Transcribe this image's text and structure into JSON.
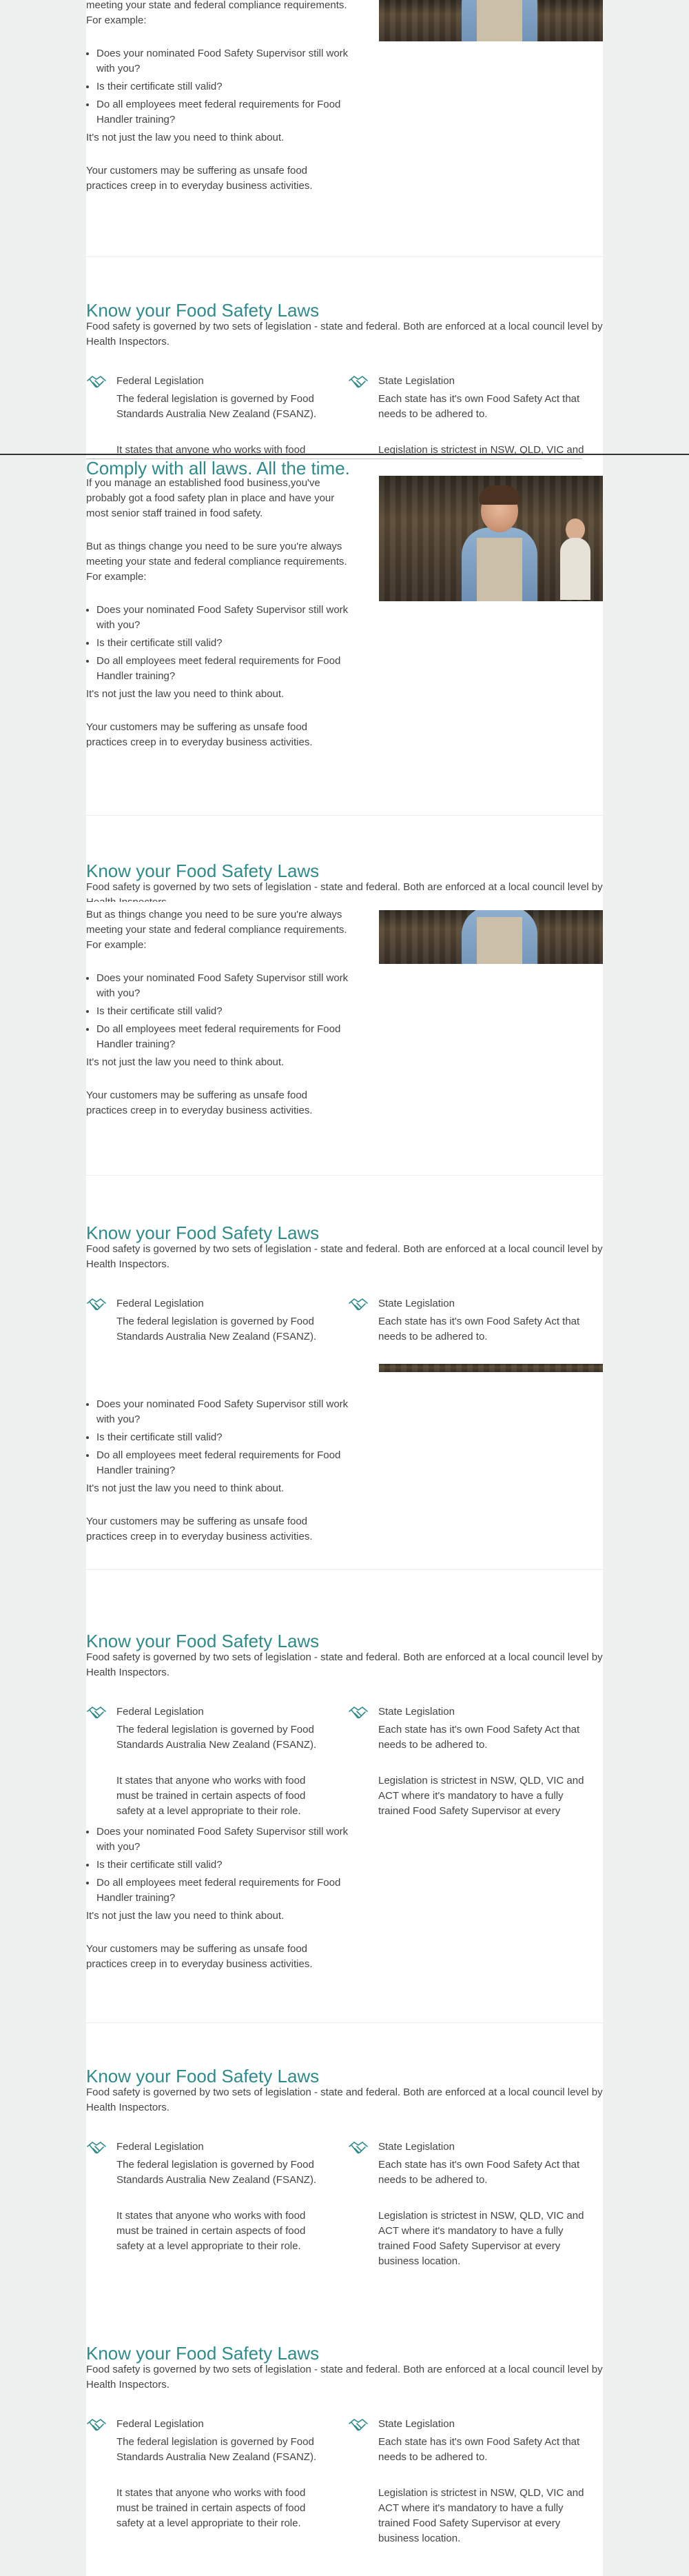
{
  "comply": {
    "title": "Comply with all laws. All the time.",
    "intro": "If you manage an established food business,you've probably got a food safety plan in place and have your most senior staff trained in food safety.",
    "change": "But as things change you need to be sure you're always meeting your state and federal compliance requirements. For example:",
    "change_tail": "meeting your state and federal compliance requirements. For example:",
    "bullets": [
      "Does your nominated Food Safety Supervisor still work with you?",
      "Is their certificate still valid?",
      "Do all employees meet federal requirements for Food Handler training?"
    ],
    "law": "It's not just the law you need to think about.",
    "customers": "Your customers may be suffering as unsafe food practices creep in to everyday business activities.",
    "photo_icon": "staff-photo-icon"
  },
  "laws": {
    "title": "Know your Food Safety Laws",
    "intro": "Food safety is governed by two sets of legislation - state and federal. Both are enforced at a local council level by Health Inspectors.",
    "federal_label": "Federal Legislation",
    "federal_body_1": "The federal legislation is governed by Food Standards Australia New Zealand (FSANZ).",
    "federal_body_2": "It states that anyone who works with food must be trained in certain aspects of food safety at a level appropriate to their role.",
    "federal_body_2_cut": "It states that anyone who works with food must",
    "state_label": "State Legislation",
    "state_body_1": "Each state has it's own Food Safety Act that needs to be adhered to.",
    "state_body_2": "Legislation is strictest in NSW, QLD, VIC and ACT where it's mandatory to have a fully trained Food Safety Supervisor at every business location.",
    "state_body_2_short": "Legislation is strictest in NSW, QLD, VIC and ACT where it's mandatory to have a fully trained Food Safety Supervisor at every",
    "state_body_2_cut": "Legislation is strictest in NSW, QLD, VIC and",
    "icon": "handshake-icon"
  }
}
